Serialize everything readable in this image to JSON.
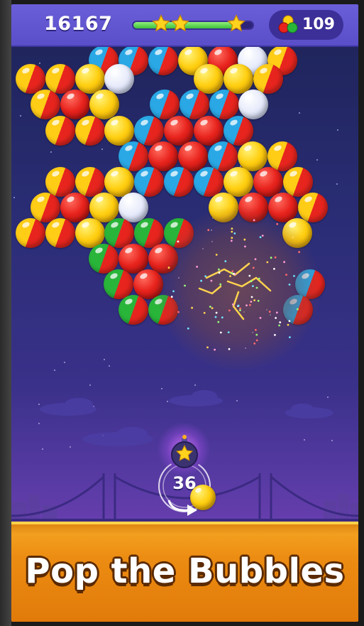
{
  "hud": {
    "score": "16167",
    "level_progress": 0.9,
    "progress_stars_earned": 3,
    "coins": "109"
  },
  "launcher": {
    "shots_remaining": "36",
    "loaded_item": "star-bomb",
    "next_bubble_color": "yellow"
  },
  "banner": {
    "caption": "Pop the Bubbles"
  },
  "colors": {
    "hud_bar": "#5a4ec9",
    "progress_fill": "#3fbf3a",
    "banner_orange": "#ec8c12",
    "bubble_red": "#e8231d",
    "bubble_yellow": "#ffcf11",
    "bubble_blue": "#2aa8e6",
    "bubble_green": "#29b53a"
  },
  "bubble_grid": [
    [
      "redblue",
      "redblue",
      "redblue",
      "yellow",
      "red",
      "white",
      "redyellow"
    ],
    [
      "redyellow",
      "redyellow",
      "yellow",
      "white",
      "yellow",
      "yellow",
      "redyellow"
    ],
    [
      "redyellow",
      "red",
      "yellow",
      "redblue",
      "redblue",
      "redblue",
      "white"
    ],
    [
      "redyellow",
      "redyellow",
      "yellow",
      "redblue",
      "red",
      "red",
      "redblue"
    ],
    [
      "redblue",
      "red",
      "red",
      "redblue",
      "yellow",
      "redyellow"
    ],
    [
      "redyellow",
      "redyellow",
      "yellow",
      "redblue",
      "redblue",
      "redblue",
      "yellow",
      "red",
      "redyellow"
    ],
    [
      "redyellow",
      "red",
      "yellow",
      "white",
      "yellow",
      "red",
      "red",
      "redyellow"
    ],
    [
      "redyellow",
      "redyellow",
      "yellow",
      "redgreen",
      "redgreen",
      "redgreen",
      "yellow"
    ],
    [
      "redgreen",
      "red",
      "red"
    ],
    [
      "redgreen",
      "red",
      "redblue"
    ],
    [
      "redgreen",
      "redgreen",
      "redblue"
    ]
  ]
}
